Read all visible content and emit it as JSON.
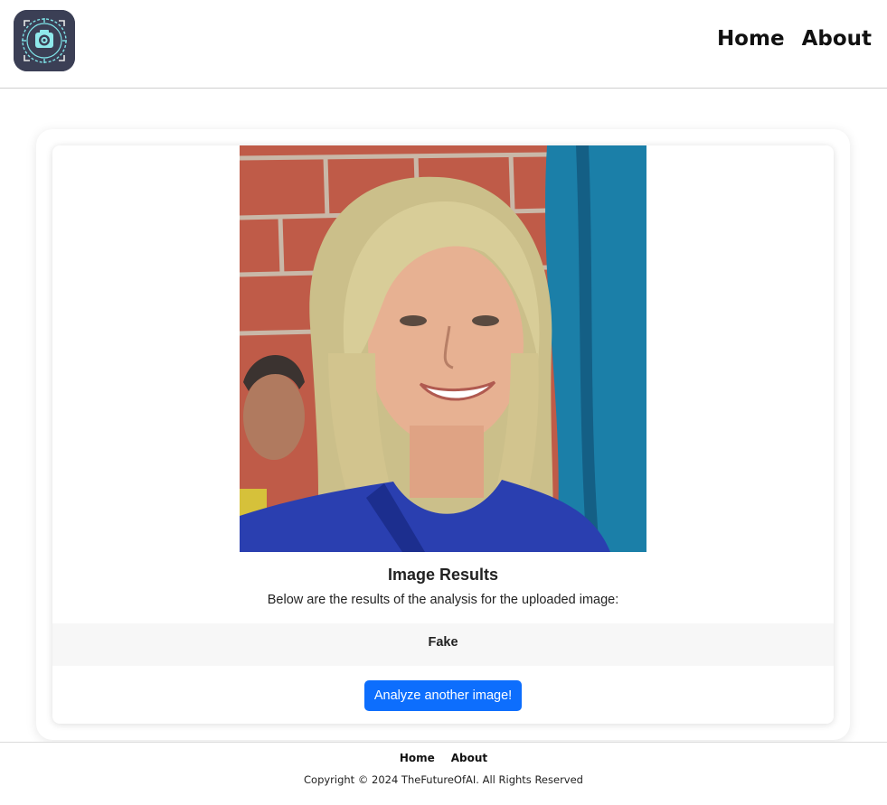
{
  "header": {
    "logo_icon": "camera-lens-scan-icon",
    "nav": [
      {
        "label": "Home"
      },
      {
        "label": "About"
      }
    ]
  },
  "result": {
    "image_description_icon": "uploaded-photo",
    "title": "Image Results",
    "subtitle": "Below are the results of the analysis for the uploaded image:",
    "verdict": "Fake",
    "analyze_again_label": "Analyze another image!"
  },
  "footer": {
    "links": [
      {
        "label": "Home"
      },
      {
        "label": "About"
      }
    ],
    "copyright": "Copyright © 2024 TheFutureOfAI. All Rights Reserved"
  },
  "colors": {
    "primary_button": "#0d6efd",
    "logo_background": "#3b3f55",
    "logo_accent": "#7fe3e8"
  }
}
